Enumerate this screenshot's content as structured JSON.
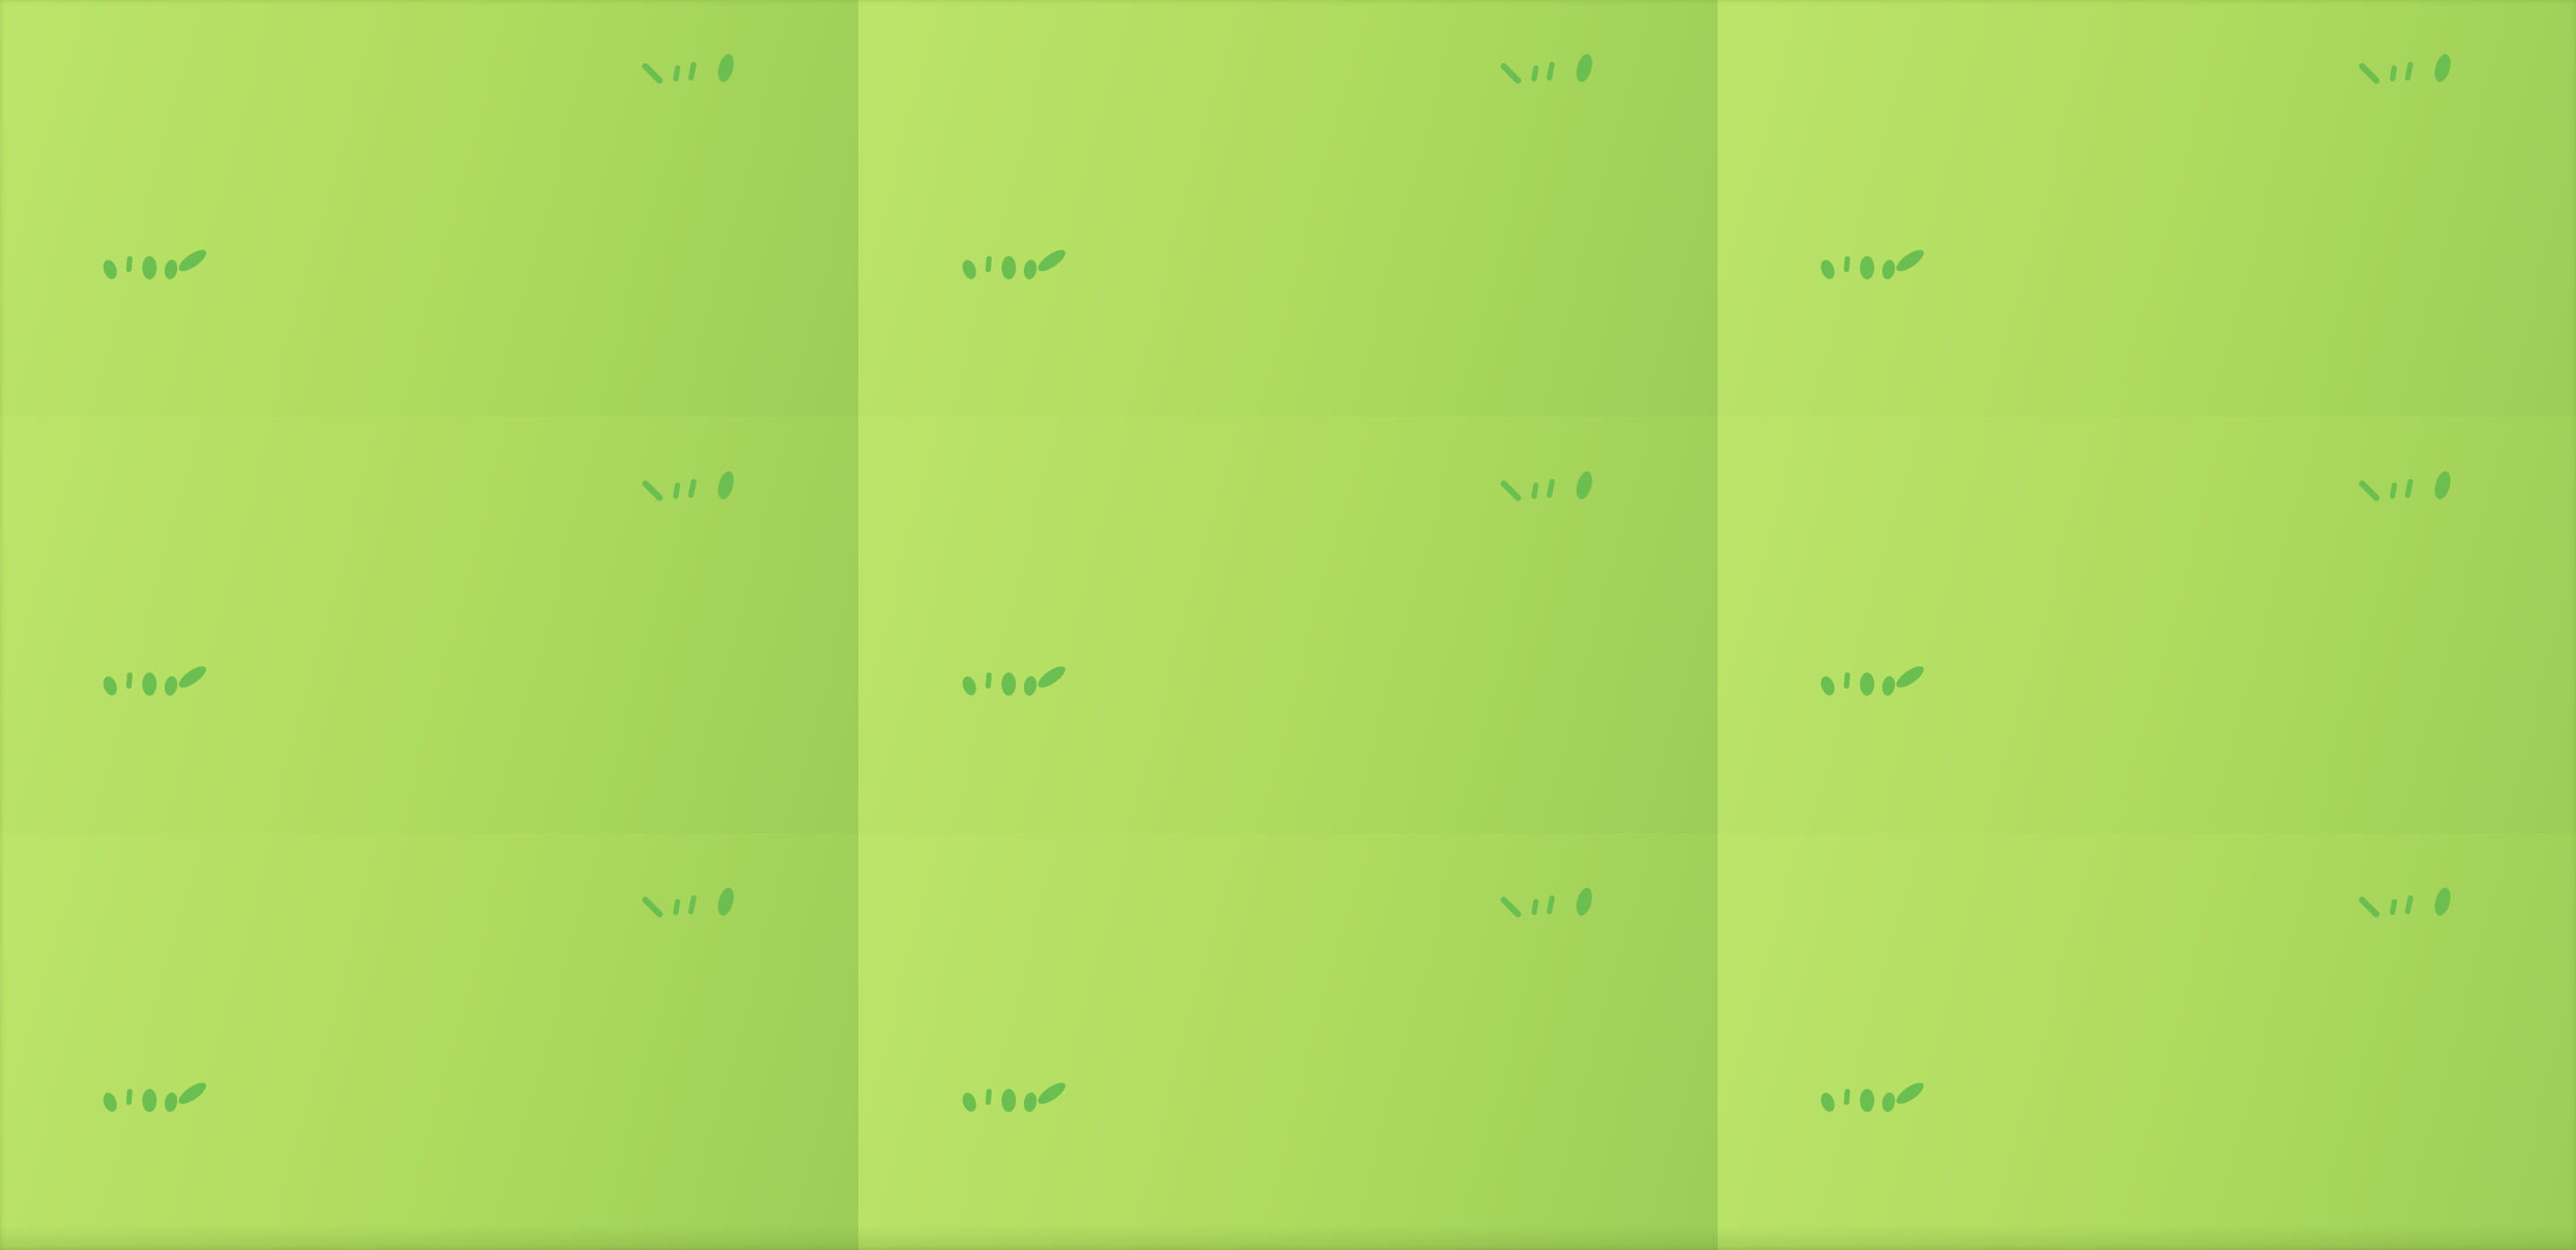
{
  "field": {
    "rows": 3,
    "columns": 3,
    "tile_icon": "grass-tuft-icon",
    "colors": {
      "grass_light": "#bce46a",
      "grass_mid": "#addb5e",
      "grass_dark": "#9dcd58",
      "tuft": "#6bbf50"
    }
  }
}
